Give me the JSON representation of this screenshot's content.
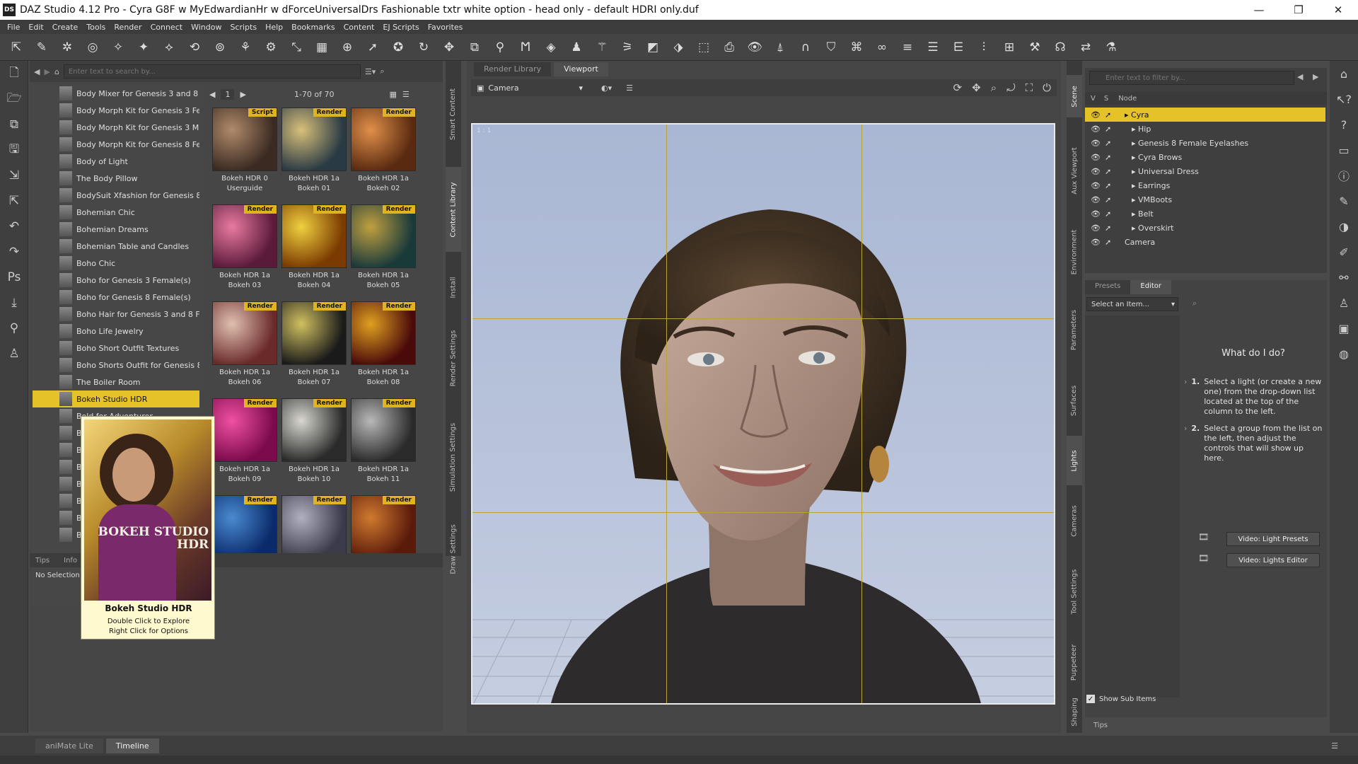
{
  "window": {
    "title": "DAZ Studio 4.12 Pro - Cyra G8F w MyEdwardianHr w dForceUniversalDrs Fashionable txtr white option - head only - default HDRI only.duf",
    "logo": "DS",
    "minimize": "—",
    "restore": "❐",
    "close": "✕"
  },
  "menu": [
    "File",
    "Edit",
    "Create",
    "Tools",
    "Render",
    "Connect",
    "Window",
    "Scripts",
    "Help",
    "Bookmarks",
    "Content",
    "EJ Scripts",
    "Favorites"
  ],
  "content_library": {
    "search_placeholder": "Enter text to search by...",
    "page": "1",
    "range": "1-70 of 70",
    "tree_items": [
      {
        "label": "Body Mixer for Genesis 3 and 8 ...",
        "selected": false
      },
      {
        "label": "Body Morph Kit for Genesis 3 Fe...",
        "selected": false
      },
      {
        "label": "Body Morph Kit for Genesis 3 M...",
        "selected": false
      },
      {
        "label": "Body Morph Kit for Genesis 8 Fe...",
        "selected": false
      },
      {
        "label": "Body of Light",
        "selected": false
      },
      {
        "label": "The Body Pillow",
        "selected": false
      },
      {
        "label": "BodySuit Xfashion for Genesis 8...",
        "selected": false
      },
      {
        "label": "Bohemian Chic",
        "selected": false
      },
      {
        "label": "Bohemian Dreams",
        "selected": false
      },
      {
        "label": "Bohemian Table and Candles",
        "selected": false
      },
      {
        "label": "Boho Chic",
        "selected": false
      },
      {
        "label": "Boho for Genesis 3 Female(s)",
        "selected": false
      },
      {
        "label": "Boho for Genesis 8 Female(s)",
        "selected": false
      },
      {
        "label": "Boho Hair for Genesis 3 and 8 F...",
        "selected": false
      },
      {
        "label": "Boho Life Jewelry",
        "selected": false
      },
      {
        "label": "Boho Short Outfit Textures",
        "selected": false
      },
      {
        "label": "Boho Shorts Outfit for Genesis 8...",
        "selected": false
      },
      {
        "label": "The Boiler Room",
        "selected": false
      },
      {
        "label": "Bokeh Studio HDR",
        "selected": true
      },
      {
        "label": "Bold for Adventurer",
        "selected": false
      },
      {
        "label": "B",
        "selected": false
      },
      {
        "label": "B",
        "selected": false
      },
      {
        "label": "B",
        "selected": false
      },
      {
        "label": "B",
        "selected": false
      },
      {
        "label": "B",
        "selected": false
      },
      {
        "label": "B",
        "selected": false
      },
      {
        "label": "B",
        "selected": false
      }
    ],
    "tiles": [
      {
        "badge": "Script",
        "line1": "Bokeh HDR 0",
        "line2": "Userguide",
        "colors": [
          "#3a2a22",
          "#b08a6a"
        ]
      },
      {
        "badge": "Render",
        "line1": "Bokeh HDR 1a",
        "line2": "Bokeh 01",
        "colors": [
          "#2a3a44",
          "#d8c07a"
        ]
      },
      {
        "badge": "Render",
        "line1": "Bokeh HDR 1a",
        "line2": "Bokeh 02",
        "colors": [
          "#5a2a10",
          "#e0904a"
        ]
      },
      {
        "badge": "Render",
        "line1": "Bokeh HDR 1a",
        "line2": "Bokeh 03",
        "colors": [
          "#5a1a3a",
          "#e87aa0"
        ]
      },
      {
        "badge": "Render",
        "line1": "Bokeh HDR 1a",
        "line2": "Bokeh 04",
        "colors": [
          "#7a3a00",
          "#f0d040"
        ]
      },
      {
        "badge": "Render",
        "line1": "Bokeh HDR 1a",
        "line2": "Bokeh 05",
        "colors": [
          "#1a3a3a",
          "#c0a040"
        ]
      },
      {
        "badge": "Render",
        "line1": "Bokeh HDR 1a",
        "line2": "Bokeh 06",
        "colors": [
          "#6a2a2a",
          "#e0c0b0"
        ]
      },
      {
        "badge": "Render",
        "line1": "Bokeh HDR 1a",
        "line2": "Bokeh 07",
        "colors": [
          "#1a1a1a",
          "#d0c060"
        ]
      },
      {
        "badge": "Render",
        "line1": "Bokeh HDR 1a",
        "line2": "Bokeh 08",
        "colors": [
          "#4a0a0a",
          "#e0a020"
        ]
      },
      {
        "badge": "Render",
        "line1": "Bokeh HDR 1a",
        "line2": "Bokeh 09",
        "colors": [
          "#7a0a4a",
          "#f050a0"
        ]
      },
      {
        "badge": "Render",
        "line1": "Bokeh HDR 1a",
        "line2": "Bokeh 10",
        "colors": [
          "#2a2a2a",
          "#d8d8d0"
        ]
      },
      {
        "badge": "Render",
        "line1": "Bokeh HDR 1a",
        "line2": "Bokeh 11",
        "colors": [
          "#2a2a2a",
          "#b8b8b8"
        ]
      },
      {
        "badge": "Render",
        "line1": "",
        "line2": "",
        "colors": [
          "#0a2a6a",
          "#4a8ad0"
        ]
      },
      {
        "badge": "Render",
        "line1": "",
        "line2": "",
        "colors": [
          "#3a3a4a",
          "#b0b0c0"
        ]
      },
      {
        "badge": "Render",
        "line1": "",
        "line2": "",
        "colors": [
          "#5a1a0a",
          "#d07a30"
        ]
      }
    ],
    "info_tabs": [
      "Tips",
      "Info"
    ],
    "no_selection": "No Selection"
  },
  "tooltip": {
    "brand": "BOKEH STUDIO HDR",
    "title": "Bokeh Studio HDR",
    "line1": "Double Click to Explore",
    "line2": "Right Click for Options"
  },
  "left_vtabs": [
    "Smart Content",
    "Content Library",
    "Install",
    "Render Settings",
    "Simulation Settings",
    "Draw Settings"
  ],
  "viewport": {
    "tabs": [
      "Render Library",
      "Viewport"
    ],
    "active_tab": "Viewport",
    "camera": "Camera",
    "aspect_label": "1 : 1"
  },
  "right_vtabs": [
    "Scene",
    "Aux Viewport",
    "Environment",
    "Parameters",
    "Surfaces",
    "Lights",
    "Cameras",
    "Tool Settings",
    "Puppeteer",
    "Shaping"
  ],
  "scene": {
    "search_placeholder": "Enter text to filter by...",
    "col_v": "V",
    "col_s": "S",
    "col_node": "Node",
    "nodes": [
      {
        "label": "Cyra",
        "depth": 0,
        "selected": true
      },
      {
        "label": "Hip",
        "depth": 1,
        "selected": false
      },
      {
        "label": "Genesis 8 Female Eyelashes",
        "depth": 1,
        "selected": false
      },
      {
        "label": "Cyra Brows",
        "depth": 1,
        "selected": false
      },
      {
        "label": "Universal Dress",
        "depth": 1,
        "selected": false
      },
      {
        "label": "Earrings",
        "depth": 1,
        "selected": false
      },
      {
        "label": "VMBoots",
        "depth": 1,
        "selected": false
      },
      {
        "label": "Belt",
        "depth": 1,
        "selected": false
      },
      {
        "label": "Overskirt",
        "depth": 1,
        "selected": false
      },
      {
        "label": "Camera",
        "depth": 0,
        "selected": false
      }
    ]
  },
  "lights": {
    "tabs": [
      "Presets",
      "Editor"
    ],
    "active_tab": "Editor",
    "select": "Select an Item...",
    "help_title": "What do I do?",
    "step1_num": "1.",
    "step1": "Select a light (or create a new one) from the drop-down list located at the top of the column to the left.",
    "step2_num": "2.",
    "step2": "Select a group from the list on the left, then adjust the controls that will show up here.",
    "btn1": "Video: Light Presets",
    "btn2": "Video: Lights Editor",
    "show_sub": "Show Sub Items",
    "tips": "Tips"
  },
  "bottom_tabs": [
    "aniMate Lite",
    "Timeline"
  ],
  "colors": {
    "accent": "#e6c229",
    "viewport_bg": "#b7c3db"
  }
}
